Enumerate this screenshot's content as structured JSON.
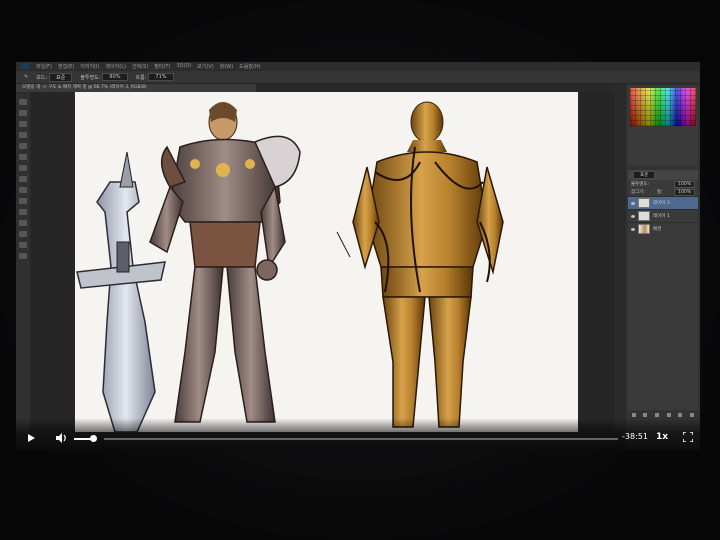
{
  "photoshop": {
    "menu_items": [
      "파일(F)",
      "편집(E)",
      "이미지(I)",
      "레이어(L)",
      "선택(S)",
      "필터(T)",
      "3D(D)",
      "보기(V)",
      "창(W)",
      "도움말(H)"
    ],
    "options": {
      "mode_label": "모드:",
      "mode_value": "표준",
      "opacity_label": "불투명도:",
      "opacity_value": "90%",
      "flow_label": "흐름:",
      "flow_value": "71%"
    },
    "document_tab": "모델링 개 -> 구도 & 배치 계획 정 @ 66.7% (레이어 3, RGB/8)",
    "layers": {
      "mode_label": "표준",
      "opacity_label": "불투명도:",
      "opacity_value": "100%",
      "fill_label": "칠:",
      "fill_value": "100%",
      "lock_label": "잠그기:",
      "items": [
        {
          "name": "레이어 3",
          "selected": true
        },
        {
          "name": "레이어 1",
          "selected": false
        },
        {
          "name": "배경",
          "selected": false
        }
      ]
    }
  },
  "video": {
    "time_remaining": "-38:51",
    "speed": "1x",
    "progress": 0.0,
    "volume": 0.8
  },
  "icons": {
    "play": "play-icon",
    "volume": "volume-icon",
    "fullscreen": "fullscreen-icon"
  },
  "colors": {
    "canvas": "#f6f4f1",
    "armor_bronze": "#b98a3a",
    "selected_layer": "#4d6a8e"
  }
}
